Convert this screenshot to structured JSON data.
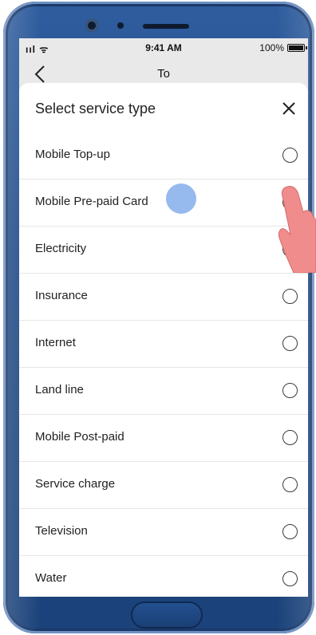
{
  "status": {
    "signal": "ııl",
    "wifi": "ᯤ",
    "time": "9:41 AM",
    "battery": "100%"
  },
  "nav": {
    "title": "To"
  },
  "sheet": {
    "title": "Select service type",
    "options": [
      {
        "label": "Mobile Top-up"
      },
      {
        "label": "Mobile Pre-paid Card"
      },
      {
        "label": "Electricity"
      },
      {
        "label": "Insurance"
      },
      {
        "label": "Internet"
      },
      {
        "label": "Land line"
      },
      {
        "label": "Mobile Post-paid"
      },
      {
        "label": "Service charge"
      },
      {
        "label": "Television"
      },
      {
        "label": "Water"
      }
    ]
  },
  "colors": {
    "phone_frame": "#1f4a86",
    "tap_indicator": "#7ca8ea",
    "hand": "#f08c8c"
  }
}
